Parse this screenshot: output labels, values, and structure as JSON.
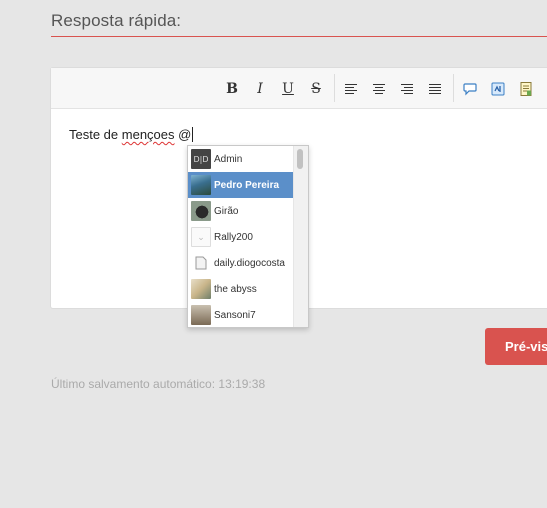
{
  "section": {
    "title": "Resposta rápida:"
  },
  "toolbar": {
    "bold_label": "B",
    "italic_label": "I",
    "underline_label": "U",
    "strike_label": "S",
    "buttons": [
      "bold",
      "italic",
      "underline",
      "strikethrough",
      "align-left-icon",
      "align-center-icon",
      "align-right-icon",
      "align-justify-icon",
      "quote-icon",
      "code-icon",
      "spoiler-icon"
    ]
  },
  "editor": {
    "text_before": "Teste de ",
    "misspelled": "mençoes",
    "text_after": " @"
  },
  "mentions": {
    "items": [
      {
        "name": "Admin",
        "selected": false
      },
      {
        "name": "Pedro Pereira",
        "selected": true
      },
      {
        "name": "Girão",
        "selected": false
      },
      {
        "name": "Rally200",
        "selected": false
      },
      {
        "name": "daily.diogocosta",
        "selected": false
      },
      {
        "name": "the abyss",
        "selected": false
      },
      {
        "name": "Sansoni7",
        "selected": false
      }
    ]
  },
  "actions": {
    "preview_label": "Pré-visu"
  },
  "status": {
    "autosave": "Último salvamento automático: 13:19:38"
  },
  "colors": {
    "accent": "#d9534f",
    "selection": "#5b8fc9",
    "background": "#e6e6e6"
  }
}
